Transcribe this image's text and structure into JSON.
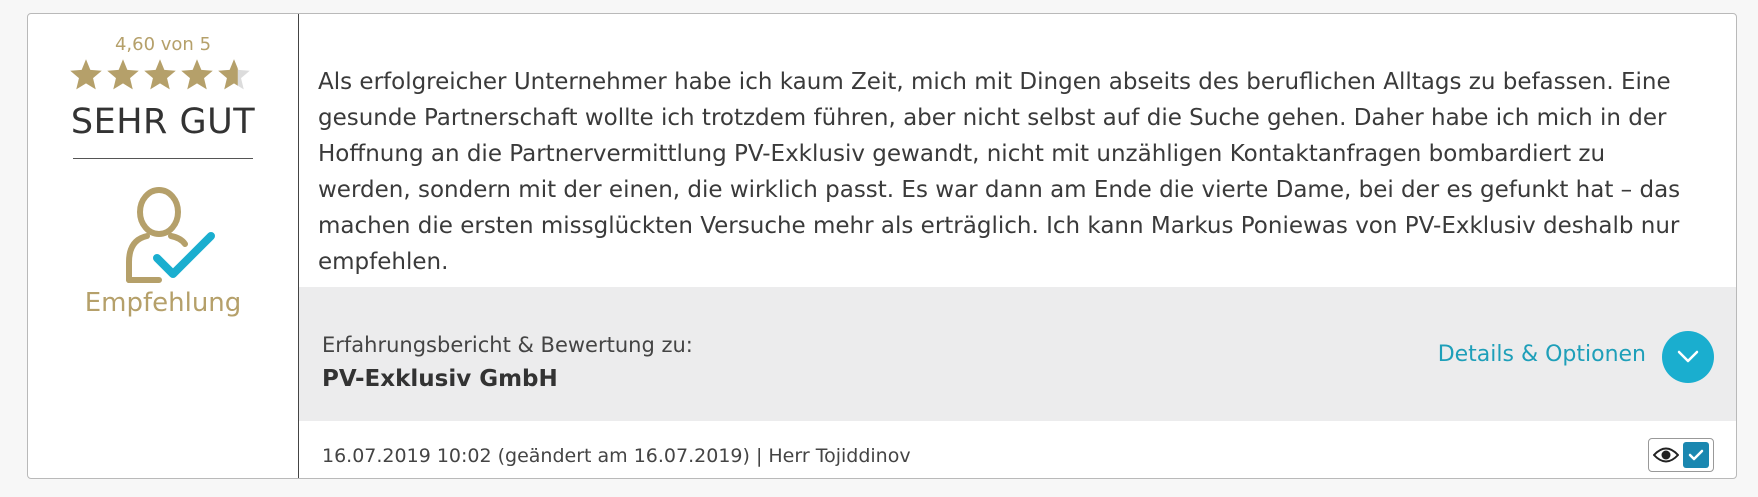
{
  "rating": {
    "score_text": "4,60 von 5",
    "stars_value": 4.6,
    "stars_max": 5,
    "verdict": "SEHR GUT",
    "badge_label": "Empfehlung",
    "accent_color": "#b5a06a"
  },
  "review": {
    "text": "Als erfolgreicher Unternehmer habe ich kaum Zeit, mich mit Dingen abseits des beruflichen Alltags zu befassen. Eine gesunde Partnerschaft wollte ich trotzdem führen, aber nicht selbst auf die Suche gehen. Daher habe ich mich in der Hoffnung an die Partnervermittlung PV-Exklusiv gewandt, nicht mit unzähligen Kontaktanfragen bombardiert zu werden, sondern mit der einen, die wirklich passt. Es war dann am Ende die vierte Dame, bei der es gefunkt hat – das machen die ersten missglückten Versuche mehr als erträglich. Ich kann Markus Poniewas von PV-Exklusiv deshalb nur empfehlen."
  },
  "subject": {
    "label": "Erfahrungsbericht & Bewertung zu:",
    "company": "PV-Exklusiv GmbH",
    "details_link": "Details & Optionen",
    "link_color": "#1e9fb9"
  },
  "footer": {
    "meta": "16.07.2019 10:02 (geändert am 16.07.2019) | Herr Tojiddinov",
    "icons": [
      "eye-icon",
      "checkbox-checked-icon"
    ]
  }
}
